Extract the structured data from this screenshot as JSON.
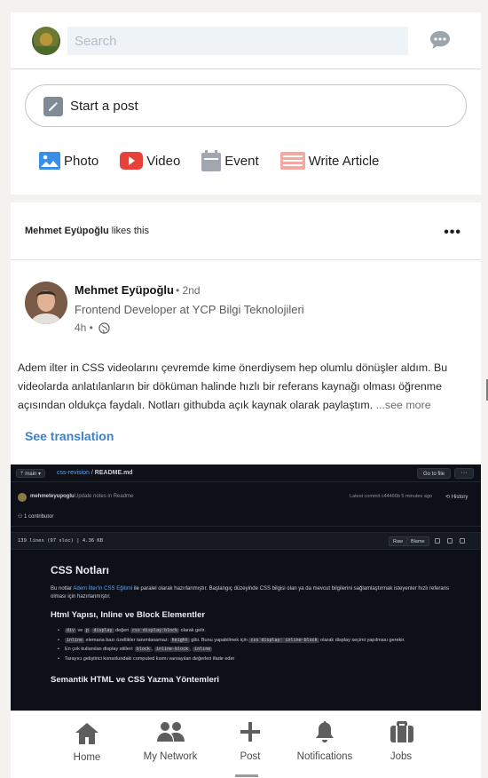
{
  "topbar": {
    "search_placeholder": "Search"
  },
  "composer": {
    "start_post_label": "Start a post",
    "actions": [
      {
        "label": "Photo",
        "icon": "photo-icon",
        "color": "#378fe9"
      },
      {
        "label": "Video",
        "icon": "video-icon",
        "color": "#e7423a"
      },
      {
        "label": "Event",
        "icon": "calendar-icon",
        "color": "#a0a7b0"
      },
      {
        "label": "Write Article",
        "icon": "article-icon",
        "color": "#f3a9a2"
      }
    ]
  },
  "post": {
    "liked_by": "Mehmet Eyüpoğlu",
    "liked_suffix": "likes this",
    "author": {
      "name": "Mehmet Eyüpoğlu",
      "degree": "• 2nd",
      "title": "Frontend Developer at YCP Bilgi Teknolojileri",
      "time": "4h •"
    },
    "text": "Adem ilter in CSS videolarını çevremde kime önerdiysem hep olumlu dönüşler aldım. Bu videolarda anlatılanların bir döküman halinde hızlı bir referans kaynağı olması öğrenme açısından oldukça faydalı. Notları githubda açık kaynak olarak paylaştım. ",
    "see_more": "...see more",
    "see_translation": "See translation",
    "screenshot": {
      "branch": "ᛘ main ▾",
      "repo": "css-revision",
      "sep": " / ",
      "file": "README.md",
      "go_to_file": "Go to file",
      "more": "···",
      "commit_user": "mehmeteyupoglu",
      "commit_msg": "Update notes in Readme",
      "latest_commit": "Latest commit c44466b 5 minutes ago",
      "history": "⟲ History",
      "contributors": "⚇ 1 contributor",
      "lines": "139 lines (97 sloc)  |  4.36 KB",
      "raw": "Raw",
      "blame": "Blame",
      "md_title": "CSS Notları",
      "md_intro_a": "Bu notlar ",
      "md_intro_link": "Adem İlter'in CSS Eğitimi",
      "md_intro_b": " ile paralel olarak hazırlanmıştır. Başlangıç düzeyinde CSS bilgisi olan ya da mevcut bilgilerini sağlamlaştırmak isteyenler hızlı referans olması için hazırlanmıştır.",
      "md_h2": "Html Yapısı, Inline ve Block Elementler",
      "bullets": [
        {
          "pre": "",
          "c1": "div",
          "mid": " ve ",
          "c2": "p",
          "mid2": " ",
          "c3": "display",
          "post": " değeri ",
          "c4": "css display:block",
          "end": " olarak gelir."
        },
        {
          "pre": "",
          "c1": "inline",
          "mid": " elemana bazı özellikler tanımlanamaz: ",
          "c2": "height",
          "mid2": " gibi. Bunu yapabilmek için ",
          "c3": "css display: inline-block",
          "post": " olarak display seçimi yapılması gerekir.",
          "c4": "",
          "end": ""
        },
        {
          "pre": "En çok kullanılan display stilleri: ",
          "c1": "block",
          "mid": ", ",
          "c2": "inline-block",
          "mid2": ", ",
          "c3": "inline",
          "post": "",
          "c4": "",
          "end": ""
        },
        {
          "pre": "Tarayıcı geliştirici konsolundaki computed kısmı varsayılan değerleri ifade eder",
          "c1": "",
          "mid": "",
          "c2": "",
          "mid2": "",
          "c3": "",
          "post": "",
          "c4": "",
          "end": ""
        }
      ],
      "md_h2_second": "Semantik HTML ve CSS Yazma Yöntemleri"
    }
  },
  "bottom_nav": [
    {
      "label": "Home",
      "icon": "home-icon"
    },
    {
      "label": "My Network",
      "icon": "network-icon"
    },
    {
      "label": "Post",
      "icon": "plus-icon"
    },
    {
      "label": "Notifications",
      "icon": "bell-icon"
    },
    {
      "label": "Jobs",
      "icon": "briefcase-icon"
    }
  ],
  "colors": {
    "link_blue": "#3a83c9",
    "nav_gray": "#5e5e5e",
    "github_bg": "#0d1117"
  }
}
